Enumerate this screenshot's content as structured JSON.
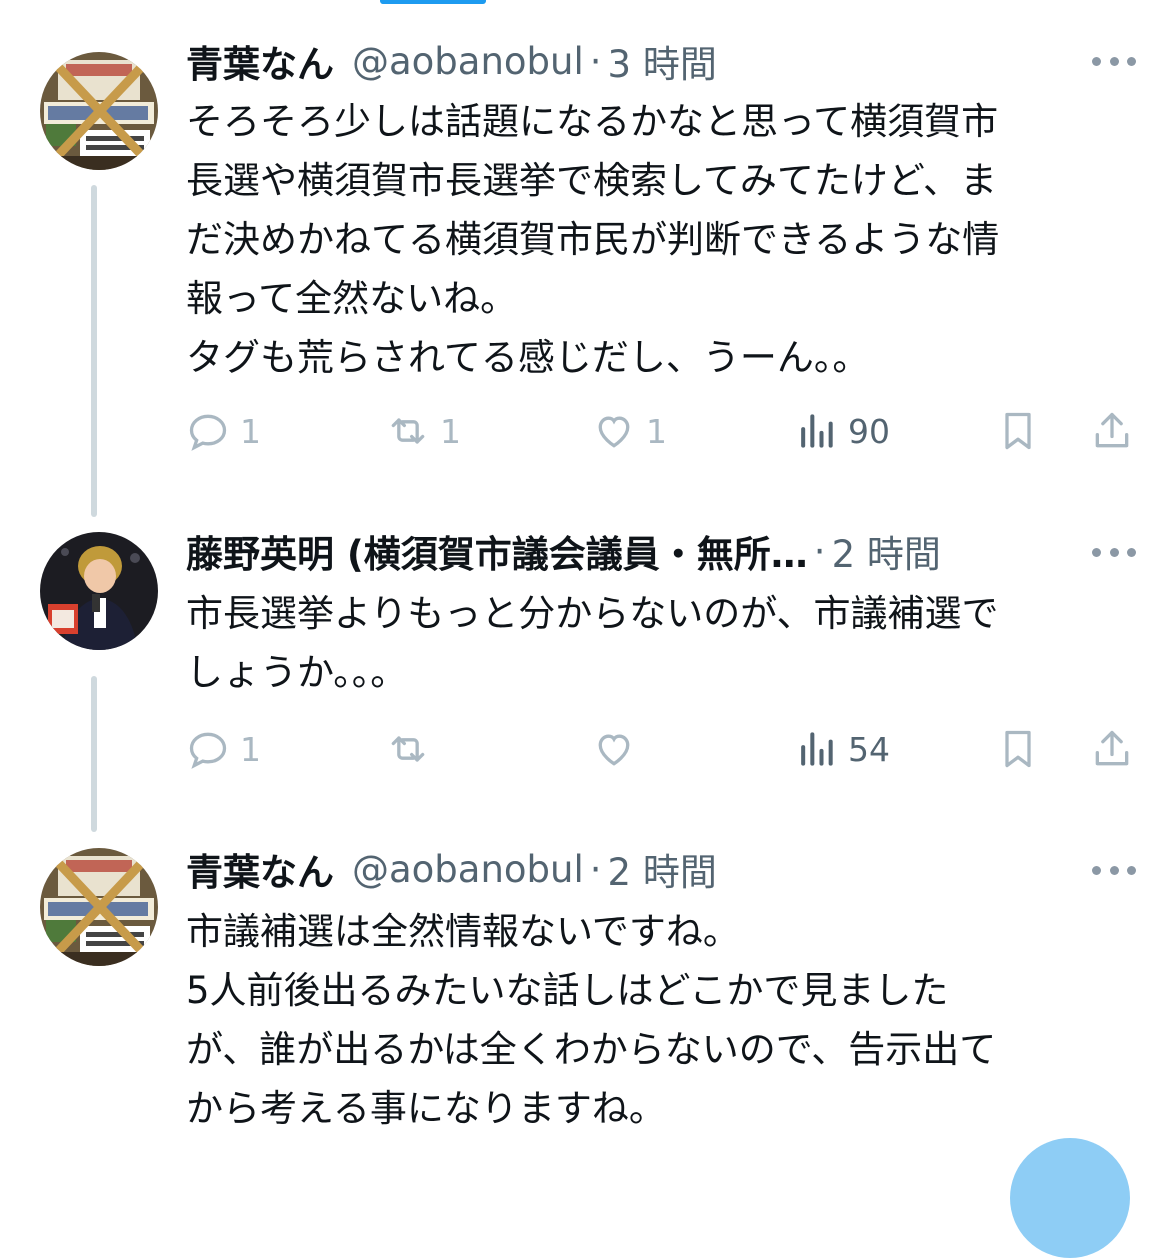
{
  "tweets": [
    {
      "name": "青葉なん",
      "handle": "@aobanobul",
      "dot": "·",
      "time": "3 時間",
      "avatar_icon": "avatar-signboard",
      "text": "そろそろ少しは話題になるかなと思って横須賀市\n長選や横須賀市長選挙で検索してみてたけど、ま\nだ決めかねてる横須賀市民が判断できるような情\n報って全然ないね。\nタグも荒らされてる感じだし、うーん。。",
      "replies": "1",
      "retweets": "1",
      "likes": "1",
      "views": "90"
    },
    {
      "name": "藤野英明 (横須賀市議会議員・無所…",
      "handle": "",
      "dot": "·",
      "time": "2 時間",
      "avatar_icon": "avatar-person-speech",
      "text": "市長選挙よりもっと分からないのが、市議補選で\nしょうか。。。",
      "replies": "1",
      "retweets": "",
      "likes": "",
      "views": "54"
    },
    {
      "name": "青葉なん",
      "handle": "@aobanobul",
      "dot": "·",
      "time": "2 時間",
      "avatar_icon": "avatar-signboard",
      "text": "市議補選は全然情報ないですね。\n5人前後出るみたいな話しはどこかで見ました\nが、誰が出るかは全くわからないので、告示出て\nから考える事になりますね。"
    }
  ],
  "colors": {
    "accent": "#1d9bf0",
    "secondary_text": "#536471",
    "icon_gray": "#aab8c2",
    "thread_line": "#cfd9de"
  }
}
